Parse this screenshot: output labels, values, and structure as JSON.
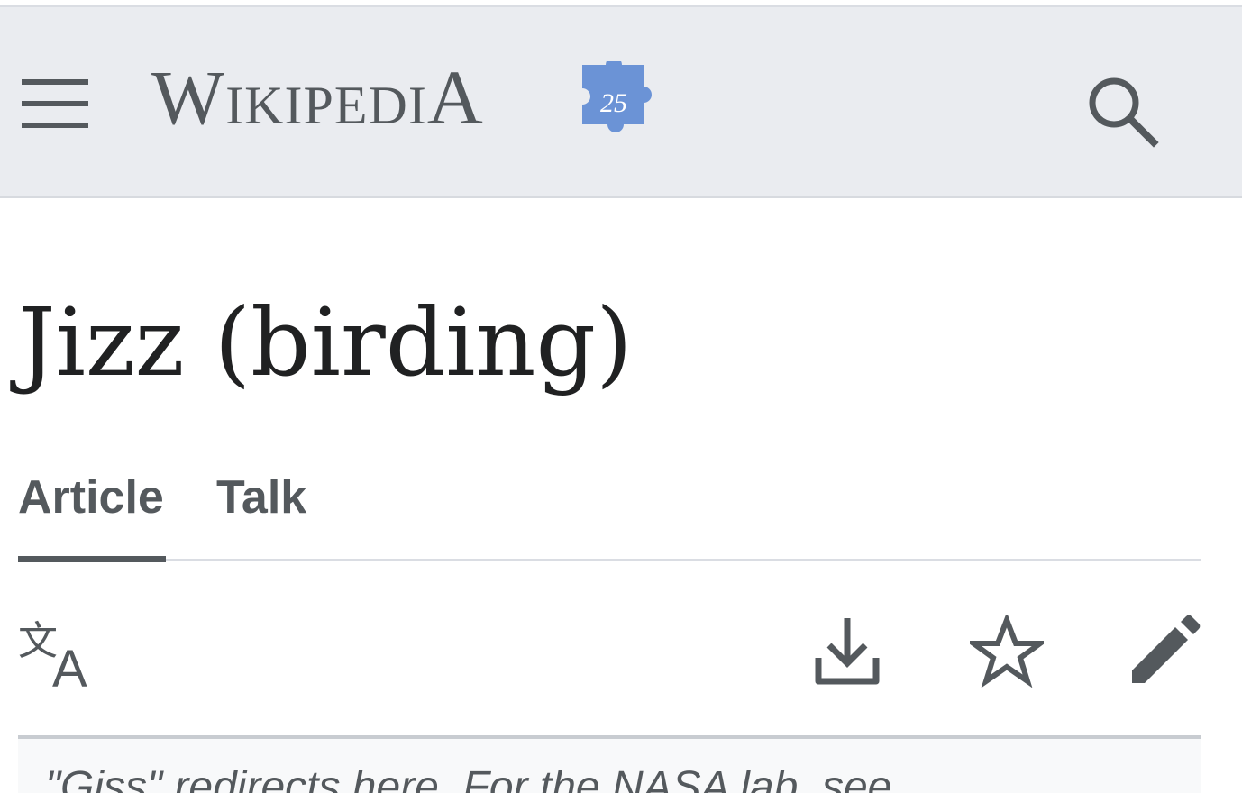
{
  "header": {
    "menu_icon": "hamburger-menu-icon",
    "logo": {
      "wordmark": "Wikipedia",
      "badge_text": "25",
      "badge_color": "#6b93d6"
    },
    "search_icon": "search-icon"
  },
  "page": {
    "title": "Jizz (birding)"
  },
  "tabs": [
    {
      "label": "Article",
      "selected": true
    },
    {
      "label": "Talk",
      "selected": false
    }
  ],
  "actions": {
    "language_icon": "language-icon",
    "download_icon": "download-icon",
    "watch_icon": "star-icon",
    "edit_icon": "pencil-icon"
  },
  "notice": {
    "text": "\"Giss\" redirects here. For the NASA lab, see"
  },
  "colors": {
    "header_bg": "#eaecf0",
    "icon": "#54595d",
    "title": "#202122",
    "notice_bg": "#f8f9fa"
  }
}
